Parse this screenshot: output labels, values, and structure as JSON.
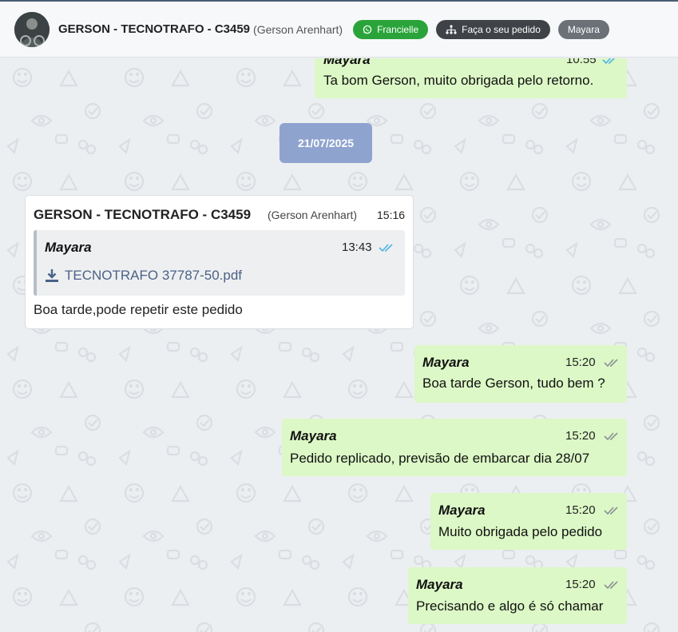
{
  "header": {
    "contact_name": "GERSON - TECNOTRAFO - C3459",
    "contact_sub": "(Gerson Arenhart)",
    "whatsapp_label": "Francielle",
    "order_label": "Faça o seu pedido",
    "agent_label": "Mayara"
  },
  "messages": {
    "top": {
      "author": "Mayara",
      "time": "10:55",
      "text": "Ta bom Gerson, muito obrigada pelo retorno."
    },
    "date_separator": "21/07/2025",
    "incoming": {
      "sender": "GERSON - TECNOTRAFO - C3459",
      "sender_sub": "(Gerson Arenhart)",
      "time": "15:16",
      "quoted": {
        "author": "Mayara",
        "time": "13:43",
        "file": "TECNOTRAFO 37787-50.pdf"
      },
      "text": "Boa tarde,pode repetir este pedido"
    },
    "m1": {
      "author": "Mayara",
      "time": "15:20",
      "text": "Boa tarde Gerson, tudo bem ?"
    },
    "m2": {
      "author": "Mayara",
      "time": "15:20",
      "text": "Pedido replicado, previsão de embarcar dia 28/07"
    },
    "m3": {
      "author": "Mayara",
      "time": "15:20",
      "text": "Muito obrigada pelo pedido"
    },
    "m4": {
      "author": "Mayara",
      "time": "15:20",
      "text": "Precisando e algo é só chamar"
    }
  },
  "colors": {
    "outgoing_bubble": "#dcf8c6",
    "date_chip": "#8fa3cf",
    "read_tick": "#4fb3e8",
    "delivered_tick": "#8a9096",
    "whatsapp_green": "#2aa43a"
  },
  "icons": {
    "read_ticks": "double-check-blue",
    "delivered_ticks": "double-check-gray",
    "file": "download-icon",
    "whatsapp": "whatsapp-icon",
    "order": "sitemap-icon"
  }
}
